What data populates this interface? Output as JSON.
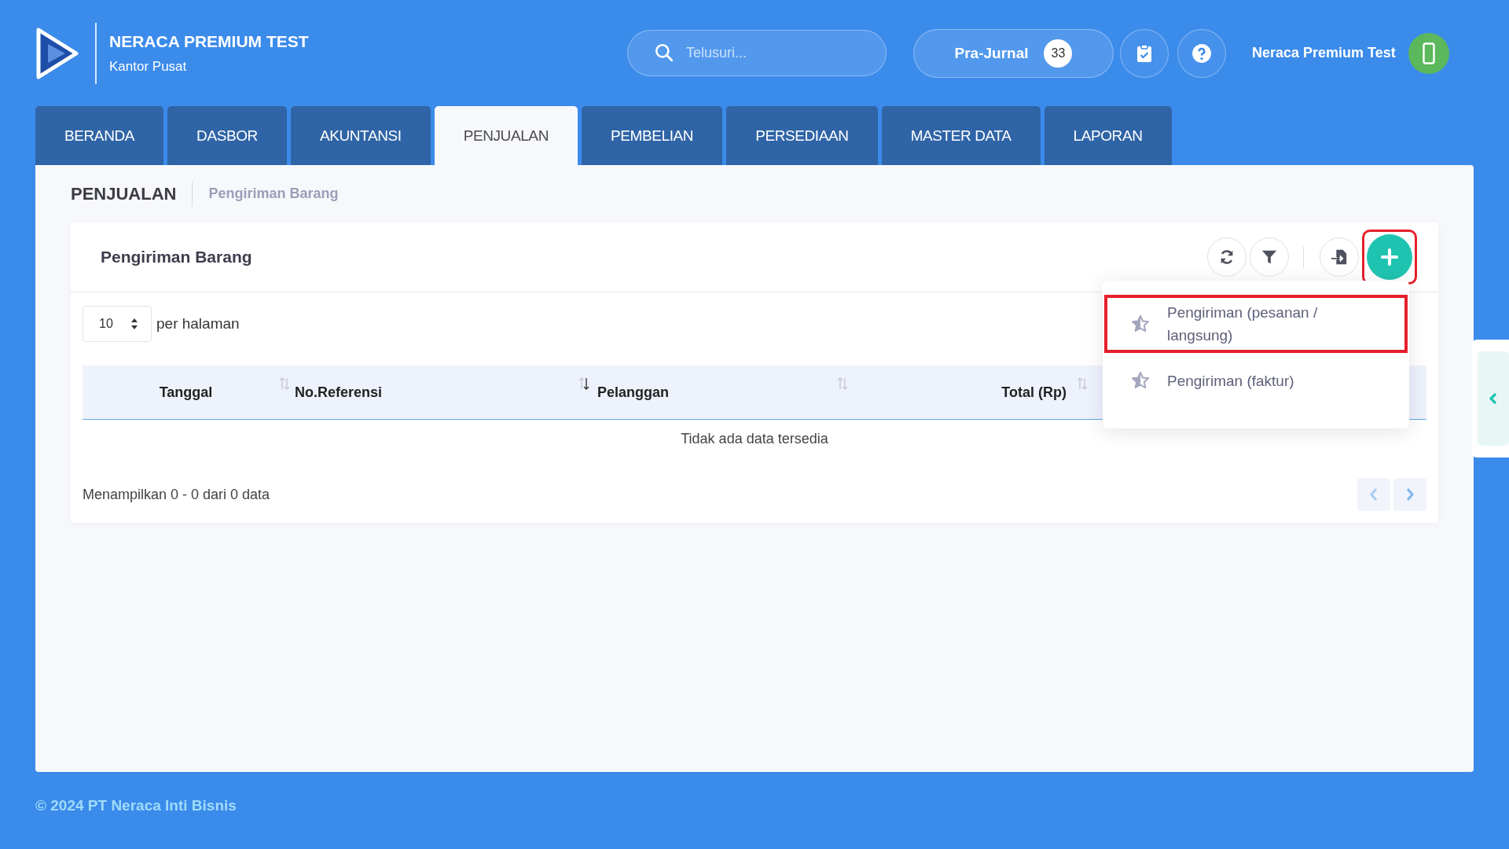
{
  "brand": {
    "title": "NERACA PREMIUM TEST",
    "subtitle": "Kantor Pusat"
  },
  "search": {
    "placeholder": "Telusuri..."
  },
  "pre_journal": {
    "label": "Pra-Jurnal",
    "count": "33"
  },
  "user": {
    "name": "Neraca Premium Test"
  },
  "tabs": [
    {
      "label": "BERANDA",
      "selected": false
    },
    {
      "label": "DASBOR",
      "selected": false
    },
    {
      "label": "AKUNTANSI",
      "selected": false
    },
    {
      "label": "PENJUALAN",
      "selected": true
    },
    {
      "label": "PEMBELIAN",
      "selected": false
    },
    {
      "label": "PERSEDIAAN",
      "selected": false
    },
    {
      "label": "MASTER DATA",
      "selected": false
    },
    {
      "label": "LAPORAN",
      "selected": false
    }
  ],
  "breadcrumb": {
    "section": "PENJUALAN",
    "page": "Pengiriman Barang"
  },
  "card": {
    "title": "Pengiriman Barang",
    "add_button": {
      "highlighted": true
    },
    "page_size": "10",
    "page_size_label": "per halaman",
    "columns": [
      {
        "label": "Tanggal",
        "sorted": false
      },
      {
        "label": "No.Referensi",
        "sorted": true
      },
      {
        "label": "Pelanggan",
        "sorted": false
      },
      {
        "label": "Total (Rp)",
        "sorted": false
      }
    ],
    "empty_message": "Tidak ada data tersedia",
    "summary": "Menampilkan 0 - 0 dari 0 data"
  },
  "add_menu": {
    "items": [
      {
        "label": "Pengiriman (pesanan / langsung)",
        "highlighted": true
      },
      {
        "label": "Pengiriman (faktur)",
        "highlighted": false
      }
    ]
  },
  "footer": "© 2024 PT Neraca Inti Bisnis"
}
